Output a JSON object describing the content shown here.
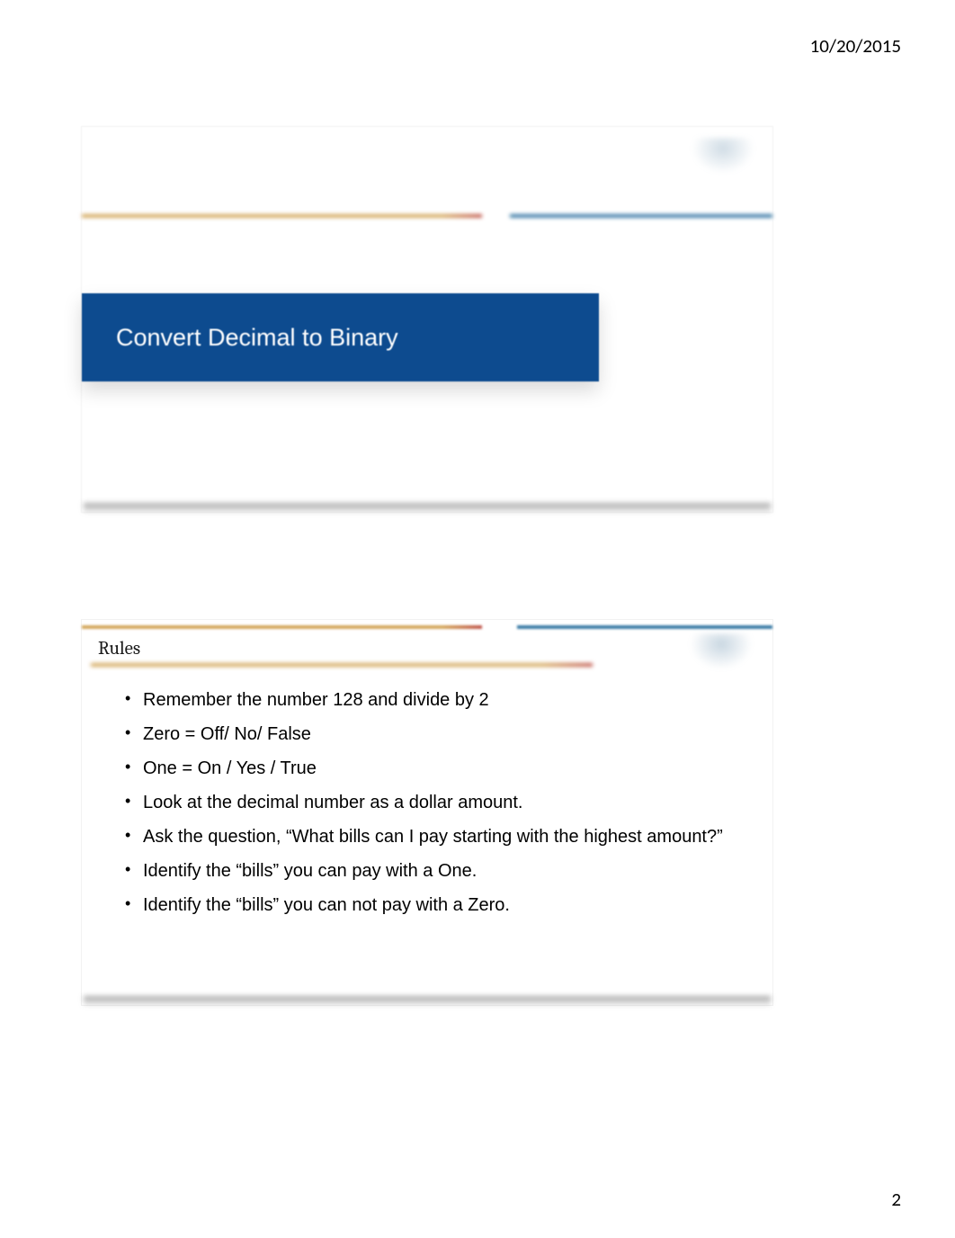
{
  "header": {
    "date": "10/20/2015"
  },
  "footer": {
    "page_number": "2"
  },
  "slide1": {
    "title": "Convert Decimal to Binary"
  },
  "slide2": {
    "title": "Rules",
    "bullets": {
      "b0": "Remember the number 128 and divide by 2",
      "b1": "Zero = Off/ No/ False",
      "b2": "One = On / Yes / True",
      "b3": "Look at the decimal number as a dollar amount.",
      "b4": "Ask the question, “What bills can I pay starting with the highest amount?”",
      "b5": "Identify the “bills” you can pay with a One.",
      "b6": "Identify the “bills” you can not pay with a Zero."
    }
  }
}
